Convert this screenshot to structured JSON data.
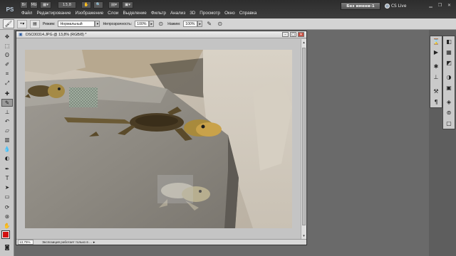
{
  "app": {
    "logo": "PS",
    "zoom_value": "13,8",
    "workspace_button": "Без имени-1",
    "cs_live": "CS Live"
  },
  "menu": [
    "Файл",
    "Редактирование",
    "Изображение",
    "Слои",
    "Выделение",
    "Фильтр",
    "Анализ",
    "3D",
    "Просмотр",
    "Окно",
    "Справка"
  ],
  "options_bar": {
    "mode_label": "Режим:",
    "mode_value": "Нормальный",
    "opacity_label": "Непрозрачность:",
    "opacity_value": "100%",
    "flow_label": "Нажим:",
    "flow_value": "100%"
  },
  "document": {
    "title": "DSC00314.JPG @ 13,8% (RGB/8) *",
    "zoom": "13,75%",
    "status_info": "Экспозиция работает только в ..."
  },
  "colors": {
    "foreground": "#d21010",
    "background": "#ffffff",
    "workspace": "#6a6a6a"
  },
  "icons": {
    "tools": [
      "move-icon",
      "marquee-icon",
      "lasso-icon",
      "quick-select-icon",
      "crop-icon",
      "eyedropper-icon",
      "healing-brush-icon",
      "brush-icon",
      "clone-stamp-icon",
      "history-brush-icon",
      "eraser-icon",
      "gradient-icon",
      "blur-icon",
      "dodge-icon",
      "pen-icon",
      "type-icon",
      "path-select-icon",
      "shape-icon",
      "3d-rotate-icon",
      "3d-orbit-icon",
      "hand-icon",
      "zoom-icon"
    ],
    "dock_left": [
      "history-panel-icon",
      "actions-panel-icon",
      "brush-panel-icon",
      "clone-source-icon",
      "tool-presets-icon",
      "character-panel-icon"
    ],
    "dock_right": [
      "color-panel-icon",
      "swatches-panel-icon",
      "adjustments-panel-icon",
      "masks-panel-icon",
      "layers-panel-icon",
      "channels-panel-icon",
      "paths-panel-icon"
    ]
  }
}
